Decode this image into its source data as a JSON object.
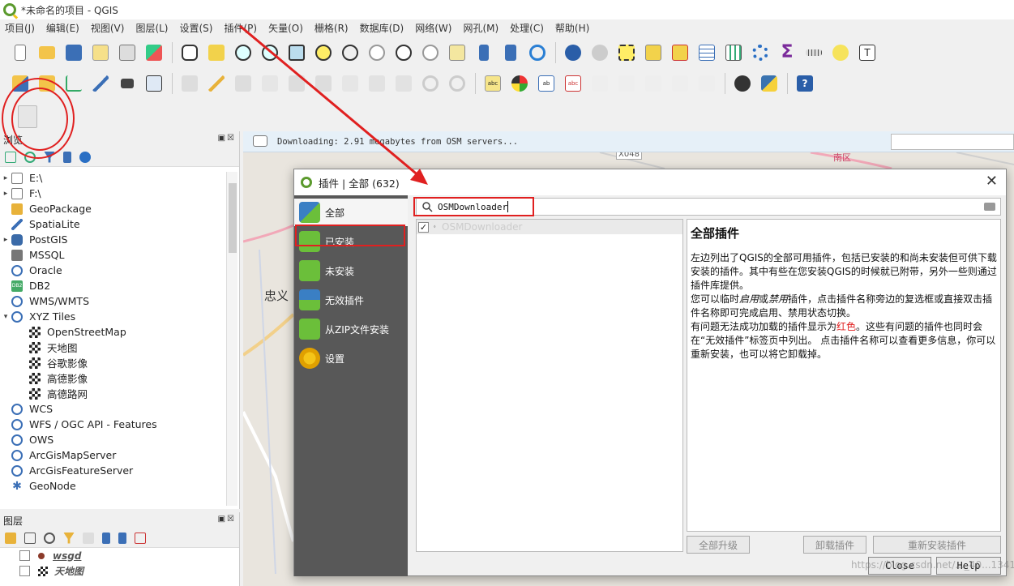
{
  "window": {
    "title": "*未命名的项目 - QGIS"
  },
  "menu": [
    "项目(J)",
    "编辑(E)",
    "视图(V)",
    "图层(L)",
    "设置(S)",
    "插件(P)",
    "矢量(O)",
    "栅格(R)",
    "数据库(D)",
    "网络(W)",
    "网孔(M)",
    "处理(C)",
    "帮助(H)"
  ],
  "browser": {
    "title": "浏览",
    "items": [
      {
        "label": "E:\\",
        "expand": "▸",
        "icon": "folder-icon"
      },
      {
        "label": "F:\\",
        "expand": "▸",
        "icon": "folder-icon"
      },
      {
        "label": "GeoPackage",
        "expand": "",
        "icon": "geopackage-icon"
      },
      {
        "label": "SpatiaLite",
        "expand": "",
        "icon": "spatialite-icon"
      },
      {
        "label": "PostGIS",
        "expand": "▸",
        "icon": "postgis-icon"
      },
      {
        "label": "MSSQL",
        "expand": "",
        "icon": "mssql-icon"
      },
      {
        "label": "Oracle",
        "expand": "",
        "icon": "oracle-icon"
      },
      {
        "label": "DB2",
        "expand": "",
        "icon": "db2-icon"
      },
      {
        "label": "WMS/WMTS",
        "expand": "",
        "icon": "globe-icon"
      },
      {
        "label": "XYZ Tiles",
        "expand": "▾",
        "icon": "globe-icon"
      }
    ],
    "xyz_children": [
      "OpenStreetMap",
      "天地图",
      "谷歌影像",
      "高德影像",
      "高德路网"
    ],
    "items_after": [
      {
        "label": "WCS",
        "icon": "globe-icon"
      },
      {
        "label": "WFS / OGC API - Features",
        "icon": "globe-icon"
      },
      {
        "label": "OWS",
        "icon": "globe-icon"
      },
      {
        "label": "ArcGisMapServer",
        "icon": "globe-icon"
      },
      {
        "label": "ArcGisFeatureServer",
        "icon": "globe-icon"
      },
      {
        "label": "GeoNode",
        "icon": "geonode-icon"
      }
    ]
  },
  "layers": {
    "title": "图层",
    "items": [
      "wsgd",
      "天地图"
    ]
  },
  "message_bar": {
    "text": "Downloading: 2.91 megabytes from OSM servers..."
  },
  "map": {
    "labels": [
      "X048",
      "忠义",
      "南区"
    ]
  },
  "dialog": {
    "title": "插件 | 全部 (632)",
    "sidebar": [
      "全部",
      "已安装",
      "未安装",
      "无效插件",
      "从ZIP文件安装",
      "设置"
    ],
    "search_value": "OSMDownloader",
    "plugin_rows": [
      "OSMDownloader"
    ],
    "info_title": "全部插件",
    "info_p1": "左边列出了QGIS的全部可用插件，包括已安装的和尚未安装但可供下载安装的插件。其中有些在您安装QGIS的时候就已附带，另外一些则通过插件库提供。",
    "info_p2a": "您可以临时",
    "info_p2_enable": "启用",
    "info_p2b": "或",
    "info_p2_disable": "禁用",
    "info_p2c": "插件，点击插件名称旁边的复选框或直接双击插件名称即可完成启用、禁用状态切换。",
    "info_p3a": "有问题无法成功加载的插件显示为",
    "info_p3_red": "红色",
    "info_p3b": "。这些有问题的插件也同时会在“无效插件”标签页中列出。 点击插件名称可以查看更多信息，你可以重新安装，也可以将它卸载掉。",
    "btn_upgrade_all": "全部升级",
    "btn_uninstall": "卸载插件",
    "btn_reinstall": "重新安装插件",
    "btn_close": "Close",
    "btn_help": "Help"
  },
  "watermark": "https://blog.csdn.net/..._40...1341",
  "colors": {
    "annotation_red": "#e02020",
    "qgis_green": "#5b9a2d",
    "sidebar_dark": "#585858"
  }
}
